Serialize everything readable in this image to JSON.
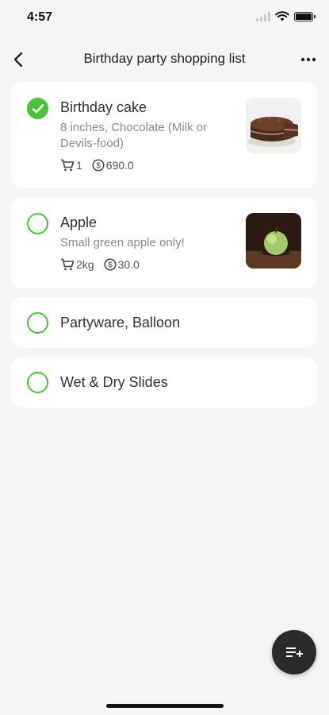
{
  "status": {
    "time": "4:57"
  },
  "header": {
    "title": "Birthday party shopping list"
  },
  "items": [
    {
      "title": "Birthday cake",
      "note": "8 inches, Chocolate (Milk or Devils-food)",
      "quantity": "1",
      "price": "690.0",
      "checked": true
    },
    {
      "title": "Apple",
      "note": "Small green apple only!",
      "quantity": "2kg",
      "price": "30.0",
      "checked": false
    },
    {
      "title": "Partyware, Balloon",
      "checked": false
    },
    {
      "title": "Wet & Dry Slides",
      "checked": false
    }
  ],
  "colors": {
    "accent": "#4cc13a",
    "background": "#f5f5f7",
    "fab": "#2a2a2a"
  },
  "icons": {
    "back": "chevron-left-icon",
    "more": "more-horizontal-icon",
    "cart": "cart-icon",
    "price": "dollar-circle-icon",
    "add_list": "playlist-add-icon"
  }
}
